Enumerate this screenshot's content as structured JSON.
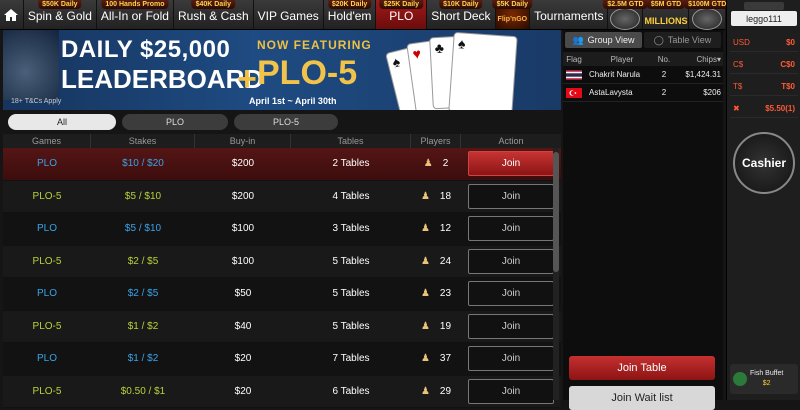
{
  "nav": {
    "tabs": [
      {
        "label": "Spin & Gold",
        "promo": "$50K Daily"
      },
      {
        "label": "All-In or Fold",
        "promo": "100 Hands Promo"
      },
      {
        "label": "Rush & Cash",
        "promo": "$40K Daily"
      },
      {
        "label": "VIP Games",
        "promo": ""
      },
      {
        "label": "Hold'em",
        "promo": "$20K Daily"
      },
      {
        "label": "PLO",
        "promo": "$25K Daily"
      },
      {
        "label": "Short Deck",
        "promo": "$10K Daily"
      },
      {
        "label": "Tournaments",
        "promo": "$5K Daily"
      }
    ],
    "flip_label": "Flip’nGO",
    "millions_label": "MILLIONS",
    "logo_promos": [
      "$2.5M GTD",
      "$5M GTD",
      "$100M GTD"
    ]
  },
  "banner": {
    "line1": "DAILY $25,000",
    "line2": "LEADERBOARD",
    "plus": "+",
    "now_featuring": "NOW FEATURING",
    "plo5": "PLO-5",
    "dates": "April 1st ~ April 30th",
    "tc": "18+ T&Cs Apply"
  },
  "filters": [
    "All",
    "PLO",
    "PLO-5"
  ],
  "columns": [
    "Games",
    "Stakes",
    "Buy-in",
    "Tables",
    "Players",
    "Action"
  ],
  "rows": [
    {
      "game": "PLO",
      "stakes": "$10 / $20",
      "buyin": "$200",
      "tables": "2 Tables",
      "players": "2",
      "action": "Join"
    },
    {
      "game": "PLO-5",
      "stakes": "$5 / $10",
      "buyin": "$200",
      "tables": "4 Tables",
      "players": "18",
      "action": "Join"
    },
    {
      "game": "PLO",
      "stakes": "$5 / $10",
      "buyin": "$100",
      "tables": "3 Tables",
      "players": "12",
      "action": "Join"
    },
    {
      "game": "PLO-5",
      "stakes": "$2 / $5",
      "buyin": "$100",
      "tables": "5 Tables",
      "players": "24",
      "action": "Join"
    },
    {
      "game": "PLO",
      "stakes": "$2 / $5",
      "buyin": "$50",
      "tables": "5 Tables",
      "players": "23",
      "action": "Join"
    },
    {
      "game": "PLO-5",
      "stakes": "$1 / $2",
      "buyin": "$40",
      "tables": "5 Tables",
      "players": "19",
      "action": "Join"
    },
    {
      "game": "PLO",
      "stakes": "$1 / $2",
      "buyin": "$20",
      "tables": "7 Tables",
      "players": "37",
      "action": "Join"
    },
    {
      "game": "PLO-5",
      "stakes": "$0.50 / $1",
      "buyin": "$20",
      "tables": "6 Tables",
      "players": "29",
      "action": "Join"
    }
  ],
  "right_panel": {
    "group_view": "Group View",
    "table_view": "Table View",
    "headers": [
      "Flag",
      "Player",
      "No.",
      "Chips"
    ],
    "players": [
      {
        "flag": "thailand-flag",
        "name": "Chakrit Narula",
        "no": "2",
        "chips": "$1,424.31"
      },
      {
        "flag": "turkey-flag",
        "name": "AstaLavysta",
        "no": "2",
        "chips": "$206"
      }
    ],
    "join_table": "Join Table",
    "join_waitlist": "Join Wait list"
  },
  "account": {
    "username": "leggo111",
    "balances": [
      {
        "label": "USD",
        "value": "$0"
      },
      {
        "label": "C$",
        "value": "C$0"
      },
      {
        "label": "T$",
        "value": "T$0"
      },
      {
        "label": "",
        "value": "$5.50(1)"
      }
    ],
    "cashier": "Cashier",
    "fish_buffet": "Fish Buffet",
    "fish_value": "$2"
  },
  "colors": {
    "accent": "#a11a1a",
    "plo": "#3aa3e8",
    "plo5": "#b6d23a",
    "balance": "#ff5a36"
  }
}
